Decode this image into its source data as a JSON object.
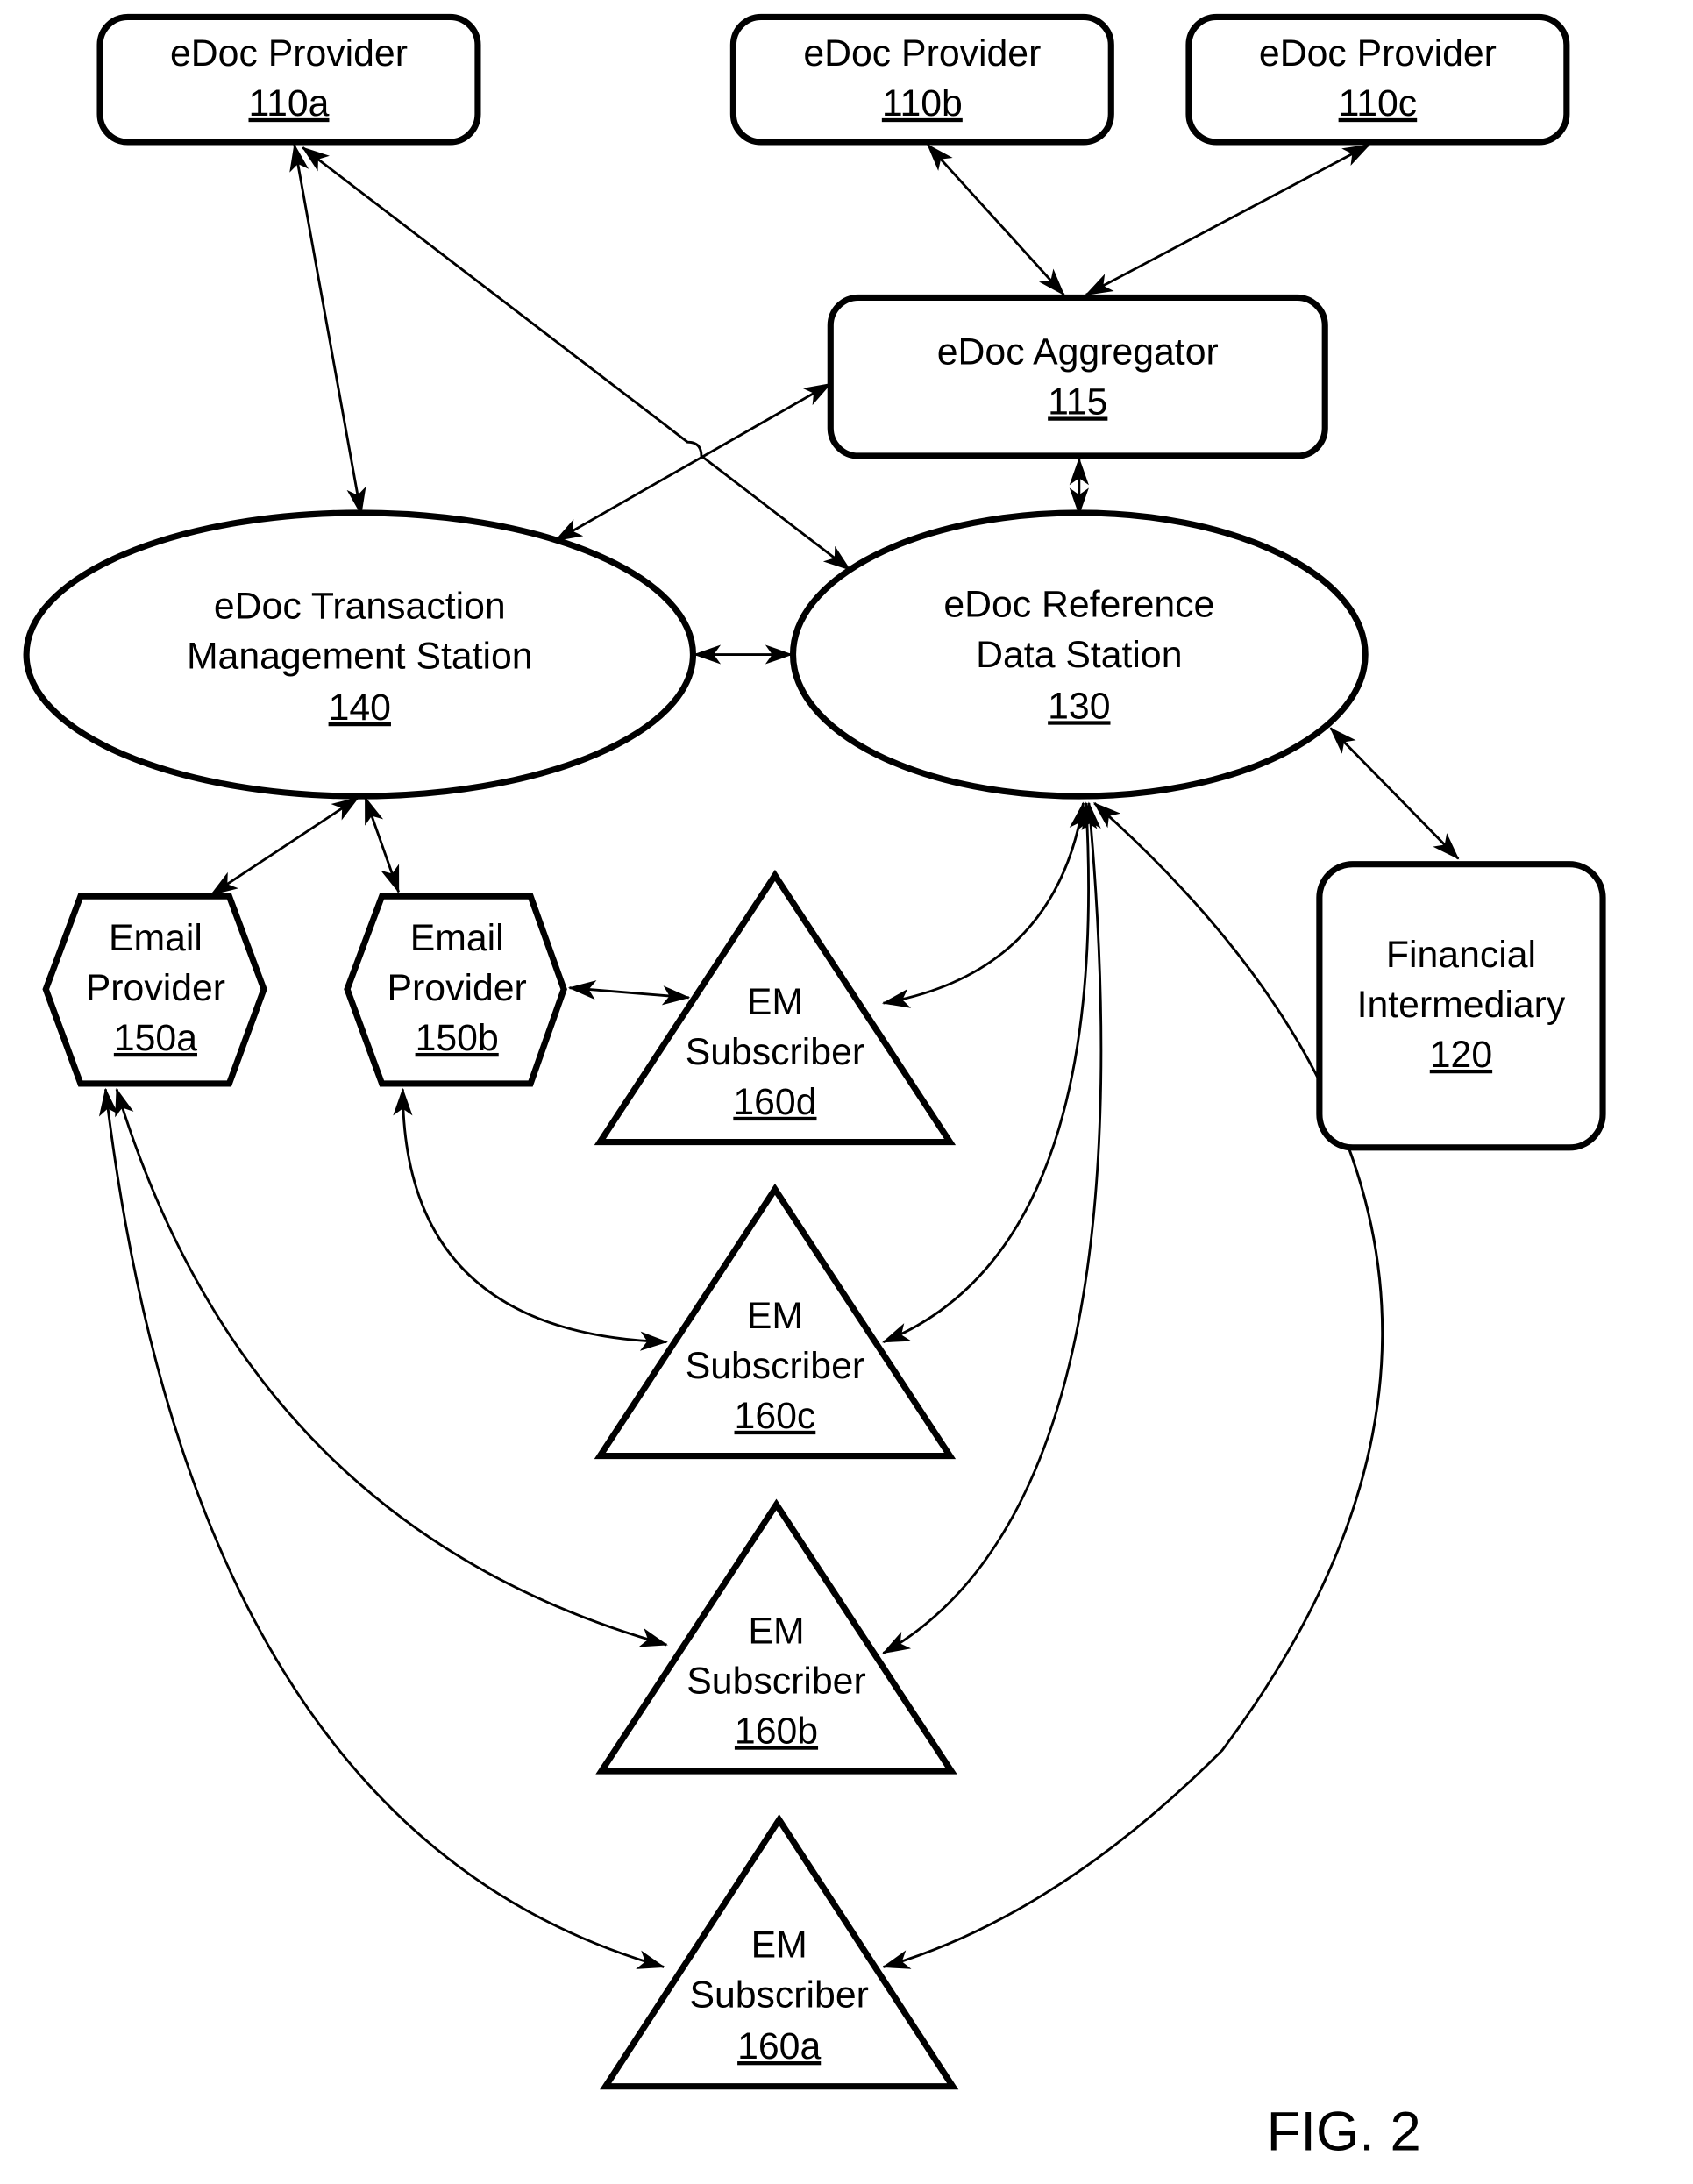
{
  "figure_label": "FIG. 2",
  "nodes": {
    "p110a": {
      "name": "eDoc Provider",
      "ref": "110a",
      "shape": "rounded-rect"
    },
    "p110b": {
      "name": "eDoc Provider",
      "ref": "110b",
      "shape": "rounded-rect"
    },
    "p110c": {
      "name": "eDoc Provider",
      "ref": "110c",
      "shape": "rounded-rect"
    },
    "agg115": {
      "name": "eDoc Aggregator",
      "ref": "115",
      "shape": "rounded-rect"
    },
    "tms140": {
      "line1": "eDoc Transaction",
      "line2": "Management Station",
      "ref": "140",
      "shape": "ellipse"
    },
    "rds130": {
      "line1": "eDoc Reference",
      "line2": "Data Station",
      "ref": "130",
      "shape": "ellipse"
    },
    "fi120": {
      "line1": "Financial",
      "line2": "Intermediary",
      "ref": "120",
      "shape": "rounded-rect"
    },
    "ep150a": {
      "line1": "Email",
      "line2": "Provider",
      "ref": "150a",
      "shape": "hexagon"
    },
    "ep150b": {
      "line1": "Email",
      "line2": "Provider",
      "ref": "150b",
      "shape": "hexagon"
    },
    "em160d": {
      "line1": "EM",
      "line2": "Subscriber",
      "ref": "160d",
      "shape": "triangle"
    },
    "em160c": {
      "line1": "EM",
      "line2": "Subscriber",
      "ref": "160c",
      "shape": "triangle"
    },
    "em160b": {
      "line1": "EM",
      "line2": "Subscriber",
      "ref": "160b",
      "shape": "triangle"
    },
    "em160a": {
      "line1": "EM",
      "line2": "Subscriber",
      "ref": "160a",
      "shape": "triangle"
    }
  },
  "edges": [
    {
      "from": "110a",
      "to": "140",
      "type": "bidirectional"
    },
    {
      "from": "110a",
      "to": "130",
      "type": "bidirectional"
    },
    {
      "from": "110b",
      "to": "115",
      "type": "bidirectional"
    },
    {
      "from": "110c",
      "to": "115",
      "type": "bidirectional"
    },
    {
      "from": "115",
      "to": "140",
      "type": "bidirectional"
    },
    {
      "from": "115",
      "to": "130",
      "type": "bidirectional"
    },
    {
      "from": "140",
      "to": "130",
      "type": "bidirectional"
    },
    {
      "from": "130",
      "to": "120",
      "type": "bidirectional"
    },
    {
      "from": "140",
      "to": "150a",
      "type": "bidirectional"
    },
    {
      "from": "140",
      "to": "150b",
      "type": "bidirectional"
    },
    {
      "from": "150b",
      "to": "160d",
      "type": "bidirectional"
    },
    {
      "from": "150b",
      "to": "160c",
      "type": "bidirectional"
    },
    {
      "from": "150a",
      "to": "160b",
      "type": "bidirectional"
    },
    {
      "from": "150a",
      "to": "160a",
      "type": "bidirectional"
    },
    {
      "from": "130",
      "to": "160d",
      "type": "bidirectional"
    },
    {
      "from": "130",
      "to": "160c",
      "type": "bidirectional"
    },
    {
      "from": "130",
      "to": "160b",
      "type": "bidirectional"
    },
    {
      "from": "130",
      "to": "160a",
      "type": "bidirectional"
    }
  ]
}
